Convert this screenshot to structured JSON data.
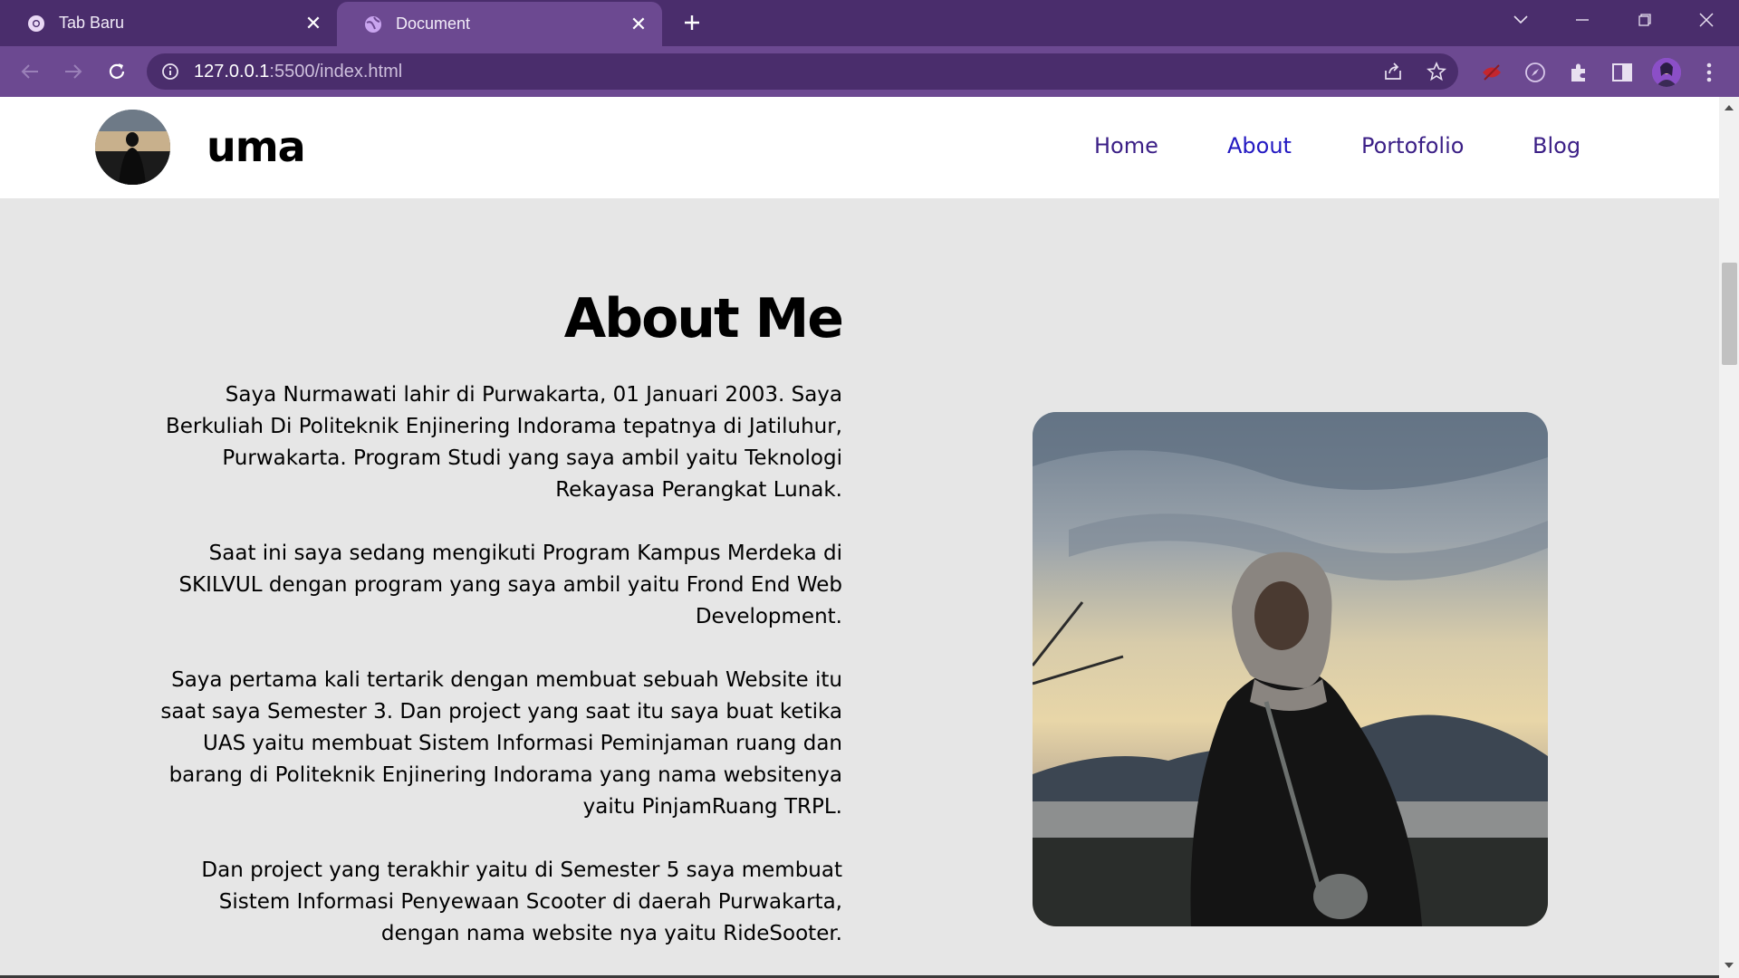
{
  "browser": {
    "tabs": [
      {
        "title": "Tab Baru",
        "active": false,
        "icon": "chrome-icon"
      },
      {
        "title": "Document",
        "active": true,
        "icon": "globe-icon"
      }
    ],
    "new_tab_icon": "plus-icon",
    "url_host": "127.0.0.1",
    "url_rest": ":5500/index.html",
    "theme_colors": {
      "frame": "#4a2d6c",
      "toolbar": "#6c4991",
      "omnibox": "#4a2d6c"
    }
  },
  "site": {
    "logo_text": "uma",
    "nav": [
      {
        "label": "Home"
      },
      {
        "label": "About",
        "active": true
      },
      {
        "label": "Portofolio"
      },
      {
        "label": "Blog"
      }
    ],
    "nav_color": "#3b1f86",
    "nav_active_color": "#2319c2"
  },
  "about": {
    "title": "About Me",
    "paragraphs": [
      "Saya Nurmawati lahir di Purwakarta, 01 Januari 2003. Saya Berkuliah Di Politeknik Enjinering Indorama tepatnya di Jatiluhur, Purwakarta. Program Studi yang saya ambil yaitu Teknologi Rekayasa Perangkat Lunak.",
      "Saat ini saya sedang mengikuti Program Kampus Merdeka di SKILVUL dengan program yang saya ambil yaitu Frond End Web Development.",
      "Saya pertama kali tertarik dengan membuat sebuah Website itu saat saya Semester 3. Dan project yang saat itu saya buat ketika UAS yaitu membuat Sistem Informasi Peminjaman ruang dan barang di Politeknik Enjinering Indorama yang nama websitenya yaitu PinjamRuang TRPL.",
      "Dan project yang terakhir yaitu di Semester 5 saya membuat Sistem Informasi Penyewaan Scooter di daerah Purwakarta, dengan nama website nya yaitu RideSooter."
    ]
  }
}
